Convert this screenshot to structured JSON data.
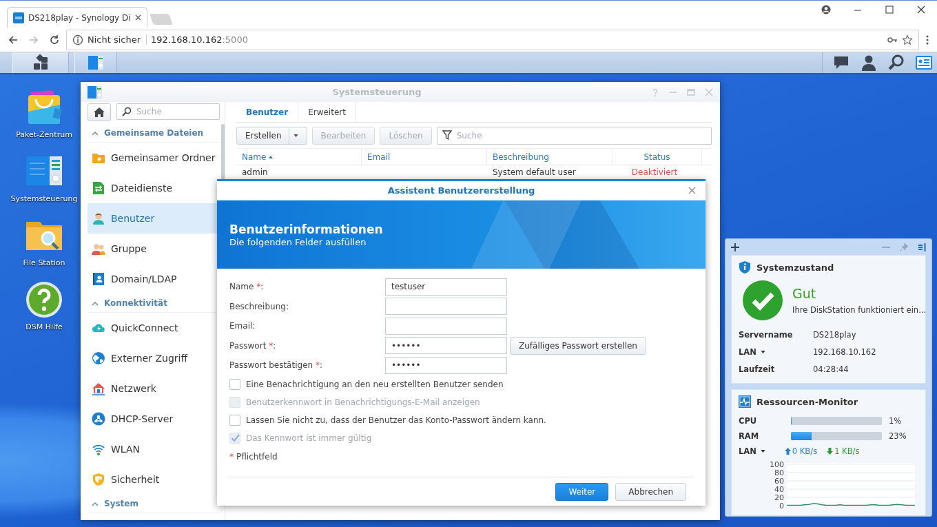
{
  "browser": {
    "tab": {
      "title": "DS218play - Synology Di",
      "selected": true
    },
    "address": {
      "security": "Nicht sicher",
      "host": "192.168.10.162",
      "port": ":5000"
    }
  },
  "desktop_icons": [
    {
      "kind": "package",
      "label": "Paket-Zentrum"
    },
    {
      "kind": "control-panel",
      "label": "Systemsteuerung"
    },
    {
      "kind": "file-station",
      "label": "File Station"
    },
    {
      "kind": "help",
      "label": "DSM Hilfe"
    }
  ],
  "control_panel": {
    "title": "Systemsteuerung",
    "search": {
      "placeholder": "Suche"
    },
    "sections": [
      {
        "title": "Gemeinsame Dateien",
        "expanded": true,
        "items": [
          {
            "kind": "shared-folder",
            "label": "Gemeinsamer Ordner",
            "selected": false
          },
          {
            "kind": "file-services",
            "label": "Dateidienste",
            "selected": false
          },
          {
            "kind": "user",
            "label": "Benutzer",
            "selected": true
          },
          {
            "kind": "group",
            "label": "Gruppe",
            "selected": false
          },
          {
            "kind": "domain",
            "label": "Domain/LDAP",
            "selected": false
          }
        ]
      },
      {
        "title": "Konnektivität",
        "expanded": true,
        "items": [
          {
            "kind": "quickconnect",
            "label": "QuickConnect",
            "selected": false
          },
          {
            "kind": "external-access",
            "label": "Externer Zugriff",
            "selected": false
          },
          {
            "kind": "network",
            "label": "Netzwerk",
            "selected": false
          },
          {
            "kind": "dhcp",
            "label": "DHCP-Server",
            "selected": false
          },
          {
            "kind": "wlan",
            "label": "WLAN",
            "selected": false
          },
          {
            "kind": "security",
            "label": "Sicherheit",
            "selected": false
          }
        ]
      },
      {
        "title": "System",
        "expanded": true
      }
    ],
    "tabs": [
      {
        "label": "Benutzer",
        "selected": true
      },
      {
        "label": "Erweitert",
        "selected": false
      }
    ],
    "toolbar": [
      {
        "label": "Erstellen",
        "disabled": false,
        "dropdown": true
      },
      {
        "label": "Bearbeiten",
        "disabled": true,
        "dropdown": false
      },
      {
        "label": "Löschen",
        "disabled": true,
        "dropdown": false
      }
    ],
    "filter": {
      "placeholder": "Suche"
    },
    "table": {
      "columns": [
        {
          "label": "Name",
          "sorted": true
        },
        {
          "label": "Email",
          "sorted": false
        },
        {
          "label": "Beschreibung",
          "sorted": false
        },
        {
          "label": "Status",
          "sorted": false
        }
      ],
      "rows": [
        {
          "name": "admin",
          "description": "System default user",
          "status": "Deaktiviert",
          "kind": "deactivated"
        }
      ]
    }
  },
  "dialog": {
    "title": "Assistent Benutzererstellung",
    "heading": "Benutzerinformationen",
    "subheading": "Die folgenden Felder ausfüllen",
    "fields": [
      {
        "label": "Name",
        "required_mark": "*",
        "label_end": ":",
        "value": "testuser"
      },
      {
        "label": "Beschreibung:"
      },
      {
        "label": "Email:"
      },
      {
        "label": "Passwort",
        "required_mark": "*",
        "label_end": ":",
        "value": "••••••",
        "button": "Zufälliges Passwort erstellen"
      },
      {
        "label": "Passwort bestätigen",
        "required_mark": "*",
        "label_end": ":",
        "value": "••••••"
      }
    ],
    "options": [
      {
        "label": "Eine Benachrichtigung an den neu erstellten Benutzer senden",
        "checked": false,
        "disabled": false
      },
      {
        "label": "Benutzerkennwort in Benachrichtigungs-E-Mail anzeigen",
        "checked": false,
        "disabled": true
      },
      {
        "label": "Lassen Sie nicht zu, dass der Benutzer das Konto-Passwort ändern kann.",
        "checked": false,
        "disabled": false
      },
      {
        "label": "Das Kennwort ist immer gültig",
        "checked": true,
        "disabled": true
      }
    ],
    "legend": {
      "mark": "*",
      "text": "Pflichtfeld"
    },
    "buttons": [
      {
        "label": "Weiter",
        "kind": "primary"
      },
      {
        "label": "Abbrechen",
        "kind": "secondary"
      }
    ]
  },
  "widgets": {
    "health": {
      "title": "Systemzustand",
      "status": "Gut",
      "message": "Ihre DiskStation funktioniert ein...",
      "rows": [
        {
          "label": "Servername",
          "value": "DS218play",
          "dropdown": false
        },
        {
          "label": "LAN",
          "value": "192.168.10.162",
          "dropdown": true
        },
        {
          "label": "Laufzeit",
          "value": "04:28:44",
          "dropdown": false
        }
      ]
    },
    "monitor": {
      "title": "Ressourcen-Monitor",
      "meters": [
        {
          "label": "CPU",
          "level": 0.01,
          "reading": "1%"
        },
        {
          "label": "RAM",
          "level": 0.23,
          "reading": "23%"
        }
      ],
      "network": {
        "label": "LAN",
        "dropdown": true,
        "upload": "0 KB/s",
        "download": "1 KB/s"
      },
      "chart_data": {
        "type": "line",
        "ylim": [
          0,
          100
        ],
        "yticks": [
          0,
          20,
          40,
          60,
          80,
          100
        ],
        "grid": true,
        "series": [
          {
            "color": "#2f8f6a",
            "values": [
              1,
              1,
              1,
              1,
              2,
              3,
              5,
              4,
              2,
              1,
              1,
              1,
              2,
              1,
              1,
              1,
              1,
              1,
              1,
              2,
              2,
              1,
              1,
              1,
              2,
              3,
              2,
              1,
              1,
              1
            ]
          }
        ]
      }
    }
  }
}
